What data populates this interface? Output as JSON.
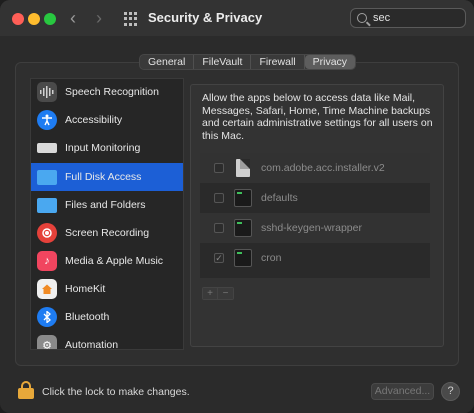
{
  "window": {
    "title": "Security & Privacy",
    "search_value": "sec"
  },
  "tabs": [
    {
      "label": "General",
      "active": false
    },
    {
      "label": "FileVault",
      "active": false
    },
    {
      "label": "Firewall",
      "active": false
    },
    {
      "label": "Privacy",
      "active": true
    }
  ],
  "sidebar": {
    "items": [
      {
        "label": "Speech Recognition",
        "icon": "waveform-icon",
        "color": "#4a4a4a"
      },
      {
        "label": "Accessibility",
        "icon": "accessibility-icon",
        "color": "#1e7cf2"
      },
      {
        "label": "Input Monitoring",
        "icon": "keyboard-icon",
        "color": "#d9d9d9"
      },
      {
        "label": "Full Disk Access",
        "icon": "folder-icon",
        "color": "#4aa8f0",
        "selected": true
      },
      {
        "label": "Files and Folders",
        "icon": "folder-icon",
        "color": "#4aa8f0"
      },
      {
        "label": "Screen Recording",
        "icon": "record-icon",
        "color": "#e5413a"
      },
      {
        "label": "Media & Apple Music",
        "icon": "music-note-icon",
        "color": "#f1455f"
      },
      {
        "label": "HomeKit",
        "icon": "home-icon",
        "color": "#f0f0f0"
      },
      {
        "label": "Bluetooth",
        "icon": "bluetooth-icon",
        "color": "#1e7cf2"
      },
      {
        "label": "Automation",
        "icon": "gear-icon",
        "color": "#8a8a8a"
      }
    ]
  },
  "main": {
    "description": "Allow the apps below to access data like Mail, Messages, Safari, Home, Time Machine backups and certain administrative settings for all users on this Mac.",
    "apps": [
      {
        "name": "com.adobe.acc.installer.v2",
        "icon": "document-icon",
        "checked": false
      },
      {
        "name": "defaults",
        "icon": "terminal-icon",
        "checked": false
      },
      {
        "name": "sshd-keygen-wrapper",
        "icon": "terminal-icon",
        "checked": false
      },
      {
        "name": "cron",
        "icon": "terminal-icon",
        "checked": true
      }
    ],
    "add_label": "+",
    "remove_label": "−"
  },
  "footer": {
    "lock_text": "Click the lock to make changes.",
    "advanced_label": "Advanced...",
    "help_label": "?"
  }
}
